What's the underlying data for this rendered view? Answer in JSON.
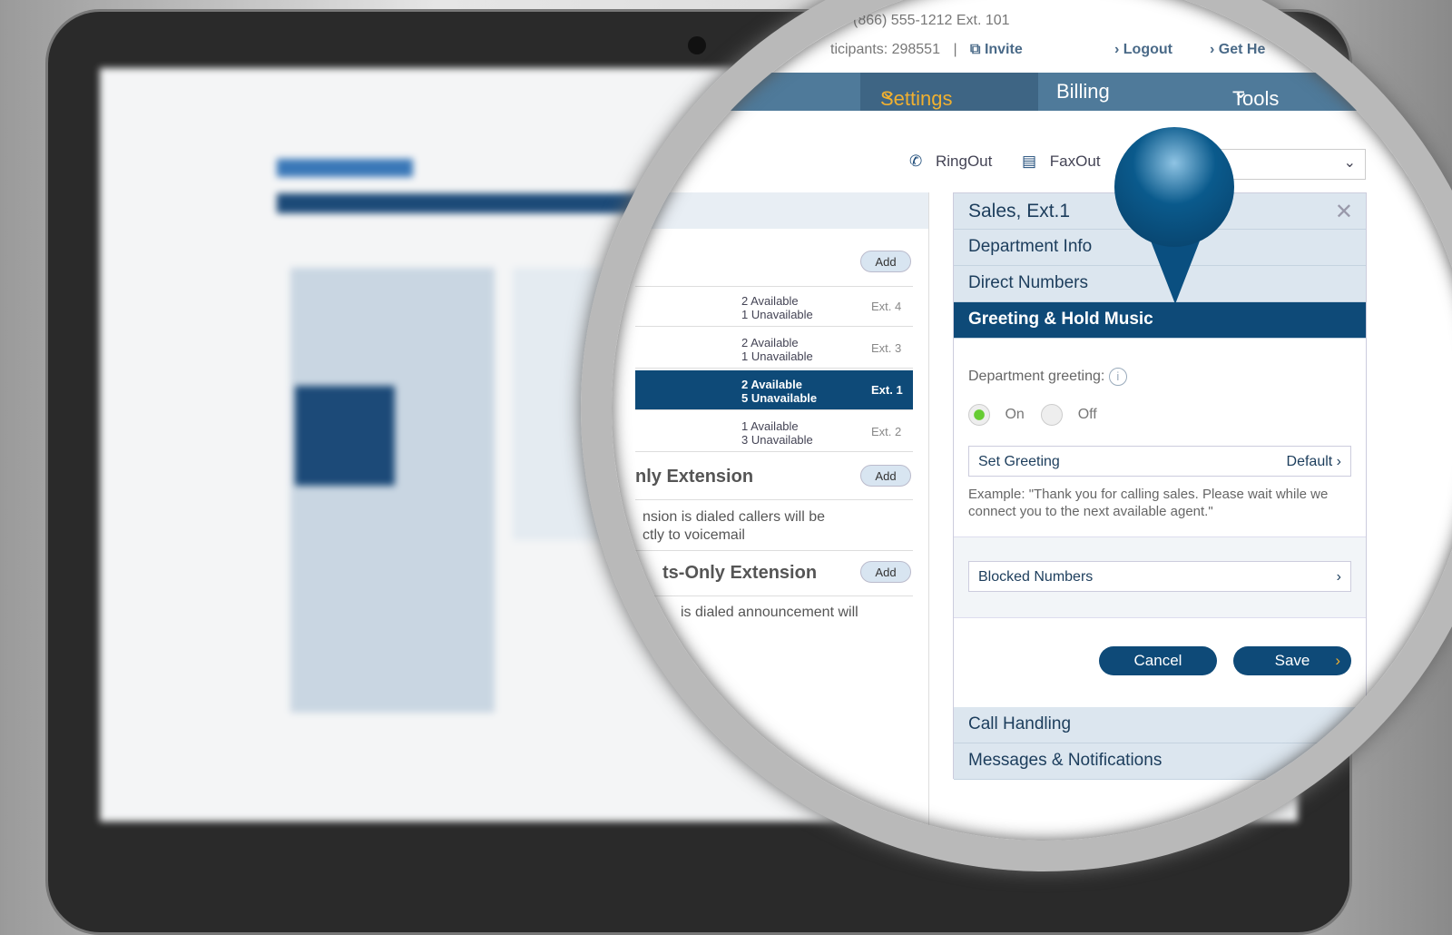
{
  "header": {
    "phone": "(866) 555-1212 Ext. 101",
    "participants": "ticipants: 298551",
    "separator": "|",
    "invite": "Invite",
    "logout": "Logout",
    "get_help": "Get He"
  },
  "nav": {
    "items": [
      {
        "label": "Settings",
        "active": true
      },
      {
        "label": "Billing"
      },
      {
        "label": "Tools"
      }
    ]
  },
  "toolbar": {
    "ringout": "RingOut",
    "faxout": "FaxOut"
  },
  "departments": {
    "add": "Add",
    "rows": [
      {
        "available": "2 Available",
        "unavailable": "1 Unavailable",
        "ext": "Ext. 4"
      },
      {
        "available": "2 Available",
        "unavailable": "1 Unavailable",
        "ext": "Ext. 3"
      },
      {
        "available": "2 Available",
        "unavailable": "5 Unavailable",
        "ext": "Ext. 1",
        "selected": true
      },
      {
        "available": "1 Available",
        "unavailable": "3 Unavailable",
        "ext": "Ext. 2"
      }
    ]
  },
  "voicemail_ext": {
    "title": "nly Extension",
    "add": "Add",
    "desc1": "nsion is dialed callers will be",
    "desc2": "ctly to voicemail"
  },
  "announce_ext": {
    "title": "ts-Only Extension",
    "add": "Add",
    "desc": "is dialed announcement will"
  },
  "panel": {
    "title": "Sales, Ext.1",
    "sections": [
      "Department Info",
      "Direct Numbers",
      "Greeting & Hold Music"
    ],
    "greeting_label": "Department greeting:",
    "on": "On",
    "off": "Off",
    "greeting_on": true,
    "set_greeting": "Set Greeting",
    "set_greeting_value": "Default",
    "example": "Example: \"Thank you for calling sales. Please wait while we connect you to the next available agent.\"",
    "blocked": "Blocked Numbers",
    "cancel": "Cancel",
    "save": "Save",
    "footer_sections": [
      "Call Handling",
      "Messages & Notifications"
    ]
  },
  "colors": {
    "nav": "#4f7a9a",
    "accent": "#f0b030",
    "selected": "#0e4a78"
  }
}
